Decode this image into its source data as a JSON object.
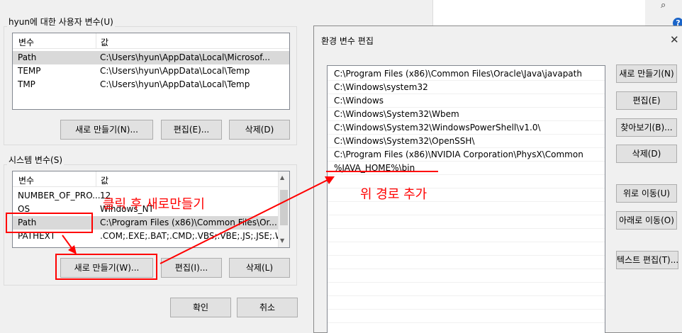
{
  "env_dialog": {
    "user_group_title": "hyun에 대한 사용자 변수(U)",
    "user_vars": {
      "col_name": "변수",
      "col_value": "값",
      "rows": [
        {
          "name": "Path",
          "value": "C:\\Users\\hyun\\AppData\\Local\\Microsof..."
        },
        {
          "name": "TEMP",
          "value": "C:\\Users\\hyun\\AppData\\Local\\Temp"
        },
        {
          "name": "TMP",
          "value": "C:\\Users\\hyun\\AppData\\Local\\Temp"
        }
      ]
    },
    "user_buttons": {
      "new": "새로 만들기(N)...",
      "edit": "편집(E)...",
      "delete": "삭제(D)"
    },
    "system_group_title": "시스템 변수(S)",
    "system_vars": {
      "col_name": "변수",
      "col_value": "값",
      "rows": [
        {
          "name": "NUMBER_OF_PRO...",
          "value": "12"
        },
        {
          "name": "OS",
          "value": "Windows_NT"
        },
        {
          "name": "Path",
          "value": "C:\\Program Files (x86)\\Common Files\\Or..."
        },
        {
          "name": "PATHEXT",
          "value": ".COM;.EXE;.BAT;.CMD;.VBS;.VBE;.JS;.JSE;.W..."
        }
      ]
    },
    "system_buttons": {
      "new": "새로 만들기(W)...",
      "edit": "편집(I)...",
      "delete": "삭제(L)"
    },
    "ok": "확인",
    "cancel": "취소"
  },
  "edit_dialog": {
    "title": "환경 변수 편집",
    "paths": [
      "C:\\Program Files (x86)\\Common Files\\Oracle\\Java\\javapath",
      "C:\\Windows\\system32",
      "C:\\Windows",
      "C:\\Windows\\System32\\Wbem",
      "C:\\Windows\\System32\\WindowsPowerShell\\v1.0\\",
      "C:\\Windows\\System32\\OpenSSH\\",
      "C:\\Program Files (x86)\\NVIDIA Corporation\\PhysX\\Common",
      "%JAVA_HOME%\\bin"
    ],
    "buttons": {
      "new": "새로 만들기(N)",
      "edit": "편집(E)",
      "browse": "찾아보기(B)...",
      "delete": "삭제(D)",
      "move_up": "위로 이동(U)",
      "move_down": "아래로 이동(O)",
      "edit_text": "텍스트 편집(T)..."
    }
  },
  "annotations": {
    "click_then_new": "클릭 후 새로만들기",
    "add_path_above": "위 경로 추가"
  },
  "colors": {
    "annotation": "#ff0000",
    "selection": "#d9d9d9",
    "dialog_bg": "#f0f0f0"
  }
}
